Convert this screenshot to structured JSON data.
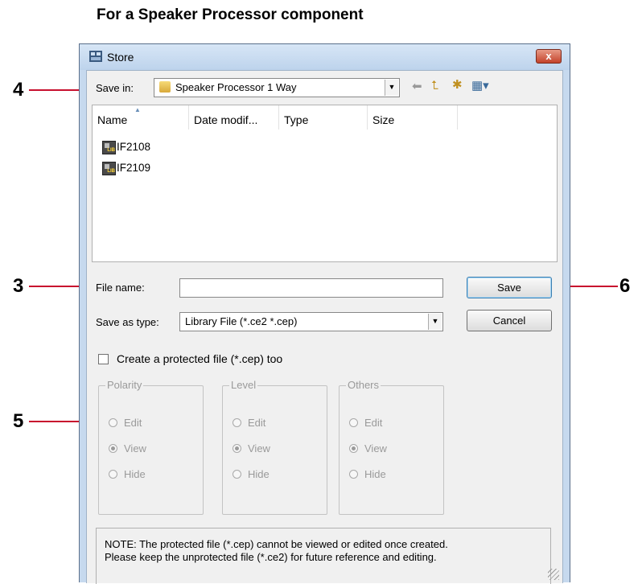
{
  "heading": "For a Speaker Processor component",
  "callouts": {
    "c4": "4",
    "c3": "3",
    "c5": "5",
    "c6": "6"
  },
  "window": {
    "title": "Store",
    "close_label": "x"
  },
  "save_in": {
    "label": "Save in:",
    "value": "Speaker Processor  1 Way"
  },
  "file_list": {
    "columns": [
      "Name",
      "Date modif...",
      "Type",
      "Size"
    ],
    "items": [
      "IF2108",
      "IF2109"
    ]
  },
  "file_name": {
    "label": "File name:",
    "value": ""
  },
  "save_as_type": {
    "label": "Save as type:",
    "value": "Library File (*.ce2 *.cep)"
  },
  "buttons": {
    "save": "Save",
    "cancel": "Cancel"
  },
  "protect": {
    "label": "Create a protected file (*.cep) too",
    "checked": false
  },
  "groups": [
    {
      "title": "Polarity",
      "options": [
        "Edit",
        "View",
        "Hide"
      ],
      "selected": "View"
    },
    {
      "title": "Level",
      "options": [
        "Edit",
        "View",
        "Hide"
      ],
      "selected": "View"
    },
    {
      "title": "Others",
      "options": [
        "Edit",
        "View",
        "Hide"
      ],
      "selected": "View"
    }
  ],
  "note": {
    "line1": "NOTE: The protected file (*.cep) cannot be viewed or edited once created.",
    "line2": "Please keep the unprotected file (*.ce2) for future reference and editing."
  },
  "colors": {
    "callout": "#c8102e",
    "window_frame": "#c6d9ee",
    "dialog_bg": "#f0f0f0"
  }
}
